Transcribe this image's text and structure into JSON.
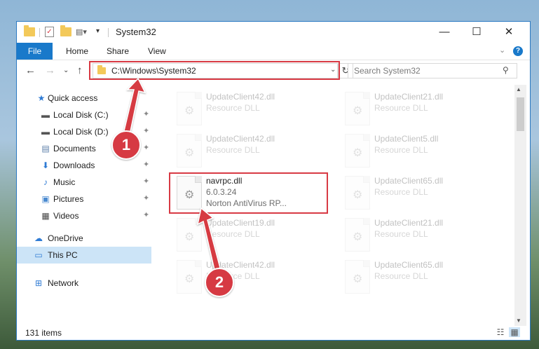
{
  "window": {
    "title": "System32",
    "controls": {
      "minimize": "—",
      "maximize": "☐",
      "close": "✕"
    }
  },
  "ribbon": {
    "file": "File",
    "tabs": [
      "Home",
      "Share",
      "View"
    ],
    "help": "?"
  },
  "address": {
    "path": "C:\\Windows\\System32",
    "search_placeholder": "Search System32"
  },
  "sidebar": {
    "items": [
      {
        "label": "Quick access",
        "icon": "star-icon",
        "pinned": false
      },
      {
        "label": "Local Disk (C:)",
        "icon": "drive-icon",
        "pinned": true
      },
      {
        "label": "Local Disk (D:)",
        "icon": "drive-icon",
        "pinned": true
      },
      {
        "label": "Documents",
        "icon": "documents-icon",
        "pinned": true
      },
      {
        "label": "Downloads",
        "icon": "download-icon",
        "pinned": true
      },
      {
        "label": "Music",
        "icon": "music-icon",
        "pinned": true
      },
      {
        "label": "Pictures",
        "icon": "pictures-icon",
        "pinned": true
      },
      {
        "label": "Videos",
        "icon": "videos-icon",
        "pinned": true
      },
      {
        "label": "OneDrive",
        "icon": "cloud-icon",
        "pinned": false
      },
      {
        "label": "This PC",
        "icon": "computer-icon",
        "pinned": false,
        "selected": true
      },
      {
        "label": "Network",
        "icon": "network-icon",
        "pinned": false
      }
    ]
  },
  "files": [
    {
      "name": "UpdateClient42.dll",
      "line1": "Resource DLL",
      "line2": "",
      "faded": true
    },
    {
      "name": "UpdateClient21.dll",
      "line1": "Resource DLL",
      "line2": "",
      "faded": true
    },
    {
      "name": "UpdateClient42.dll",
      "line1": "Resource DLL",
      "line2": "",
      "faded": true
    },
    {
      "name": "UpdateClient5.dll",
      "line1": "Resource DLL",
      "line2": "",
      "faded": true
    },
    {
      "name": "navrpc.dll",
      "line1": "6.0.3.24",
      "line2": "Norton AntiVirus RP...",
      "faded": false
    },
    {
      "name": "UpdateClient65.dll",
      "line1": "Resource DLL",
      "line2": "",
      "faded": true
    },
    {
      "name": "UpdateClient19.dll",
      "line1": "Resource DLL",
      "line2": "",
      "faded": true
    },
    {
      "name": "UpdateClient21.dll",
      "line1": "Resource DLL",
      "line2": "",
      "faded": true
    },
    {
      "name": "UpdateClient42.dll",
      "line1": "Resource DLL",
      "line2": "",
      "faded": true
    },
    {
      "name": "UpdateClient65.dll",
      "line1": "Resource DLL",
      "line2": "",
      "faded": true
    }
  ],
  "status": {
    "count": "131 items"
  },
  "annotations": {
    "step1": "1",
    "step2": "2",
    "accent": "#d63a43"
  }
}
